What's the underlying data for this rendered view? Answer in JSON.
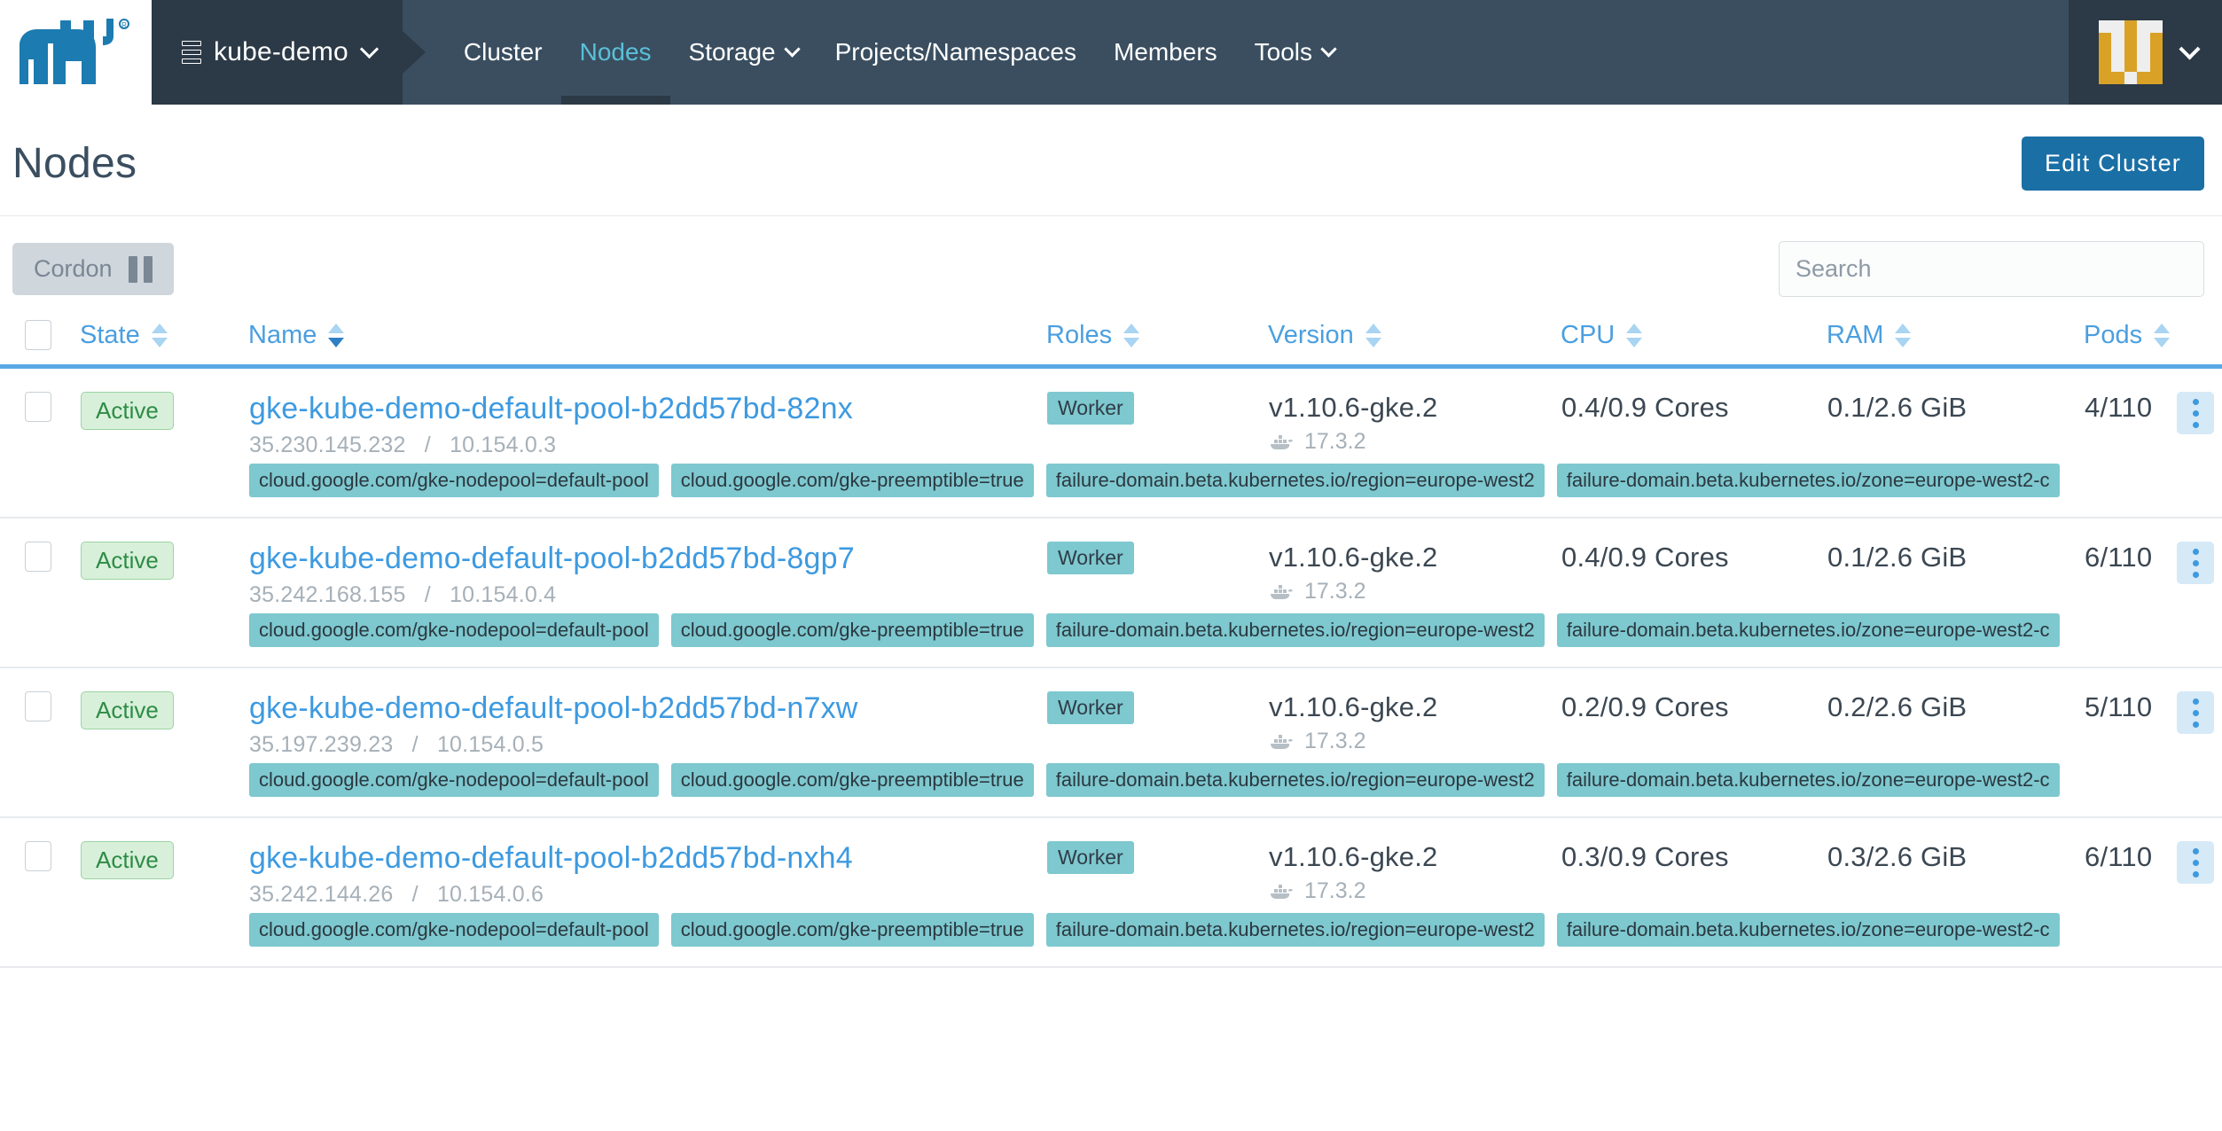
{
  "nav": {
    "logo_name": "rancher-cow-logo",
    "cluster": {
      "label": "kube-demo",
      "icon": "cluster-stack-icon"
    },
    "items": [
      {
        "label": "Cluster",
        "active": false,
        "caret": false
      },
      {
        "label": "Nodes",
        "active": true,
        "caret": false
      },
      {
        "label": "Storage",
        "active": false,
        "caret": true
      },
      {
        "label": "Projects/Namespaces",
        "active": false,
        "caret": false
      },
      {
        "label": "Members",
        "active": false,
        "caret": false
      },
      {
        "label": "Tools",
        "active": false,
        "caret": true
      }
    ],
    "avatar": {
      "name": "user-avatar-identicon",
      "fg": "#d9a227",
      "bg": "#eeeeee"
    }
  },
  "page": {
    "title": "Nodes",
    "edit_cluster_label": "Edit Cluster"
  },
  "toolbar": {
    "cordon_label": "Cordon",
    "cordon_icon": "pause-icon",
    "cordon_disabled": true,
    "search_placeholder": "Search",
    "search_value": ""
  },
  "table": {
    "columns": [
      {
        "key": "checkbox",
        "label": "",
        "sortable": false
      },
      {
        "key": "state",
        "label": "State",
        "sortable": true,
        "sort": "none"
      },
      {
        "key": "name",
        "label": "Name",
        "sortable": true,
        "sort": "asc"
      },
      {
        "key": "roles",
        "label": "Roles",
        "sortable": true,
        "sort": "none"
      },
      {
        "key": "version",
        "label": "Version",
        "sortable": true,
        "sort": "none"
      },
      {
        "key": "cpu",
        "label": "CPU",
        "sortable": true,
        "sort": "none"
      },
      {
        "key": "ram",
        "label": "RAM",
        "sortable": true,
        "sort": "none"
      },
      {
        "key": "pods",
        "label": "Pods",
        "sortable": true,
        "sort": "none"
      }
    ],
    "rows": [
      {
        "state": "Active",
        "name": "gke-kube-demo-default-pool-b2dd57bd-82nx",
        "external_ip": "35.230.145.232",
        "internal_ip": "10.154.0.3",
        "ip_separator": "/",
        "role": "Worker",
        "version": "v1.10.6-gke.2",
        "docker_version": "17.3.2",
        "cpu": "0.4/0.9 Cores",
        "ram": "0.1/2.6 GiB",
        "pods": "4/110",
        "labels": [
          "cloud.google.com/gke-nodepool=default-pool",
          "cloud.google.com/gke-preemptible=true",
          "failure-domain.beta.kubernetes.io/region=europe-west2",
          "failure-domain.beta.kubernetes.io/zone=europe-west2-c"
        ]
      },
      {
        "state": "Active",
        "name": "gke-kube-demo-default-pool-b2dd57bd-8gp7",
        "external_ip": "35.242.168.155",
        "internal_ip": "10.154.0.4",
        "ip_separator": "/",
        "role": "Worker",
        "version": "v1.10.6-gke.2",
        "docker_version": "17.3.2",
        "cpu": "0.4/0.9 Cores",
        "ram": "0.1/2.6 GiB",
        "pods": "6/110",
        "labels": [
          "cloud.google.com/gke-nodepool=default-pool",
          "cloud.google.com/gke-preemptible=true",
          "failure-domain.beta.kubernetes.io/region=europe-west2",
          "failure-domain.beta.kubernetes.io/zone=europe-west2-c"
        ]
      },
      {
        "state": "Active",
        "name": "gke-kube-demo-default-pool-b2dd57bd-n7xw",
        "external_ip": "35.197.239.23",
        "internal_ip": "10.154.0.5",
        "ip_separator": "/",
        "role": "Worker",
        "version": "v1.10.6-gke.2",
        "docker_version": "17.3.2",
        "cpu": "0.2/0.9 Cores",
        "ram": "0.2/2.6 GiB",
        "pods": "5/110",
        "labels": [
          "cloud.google.com/gke-nodepool=default-pool",
          "cloud.google.com/gke-preemptible=true",
          "failure-domain.beta.kubernetes.io/region=europe-west2",
          "failure-domain.beta.kubernetes.io/zone=europe-west2-c"
        ]
      },
      {
        "state": "Active",
        "name": "gke-kube-demo-default-pool-b2dd57bd-nxh4",
        "external_ip": "35.242.144.26",
        "internal_ip": "10.154.0.6",
        "ip_separator": "/",
        "role": "Worker",
        "version": "v1.10.6-gke.2",
        "docker_version": "17.3.2",
        "cpu": "0.3/0.9 Cores",
        "ram": "0.3/2.6 GiB",
        "pods": "6/110",
        "labels": [
          "cloud.google.com/gke-nodepool=default-pool",
          "cloud.google.com/gke-preemptible=true",
          "failure-domain.beta.kubernetes.io/region=europe-west2",
          "failure-domain.beta.kubernetes.io/zone=europe-west2-c"
        ]
      }
    ]
  },
  "colors": {
    "nav_bg": "#3a4e60",
    "nav_chip_bg": "#2c3946",
    "accent_blue": "#3d9ae0",
    "primary_button": "#1a6fa5",
    "active_badge_bg": "#d8f0da",
    "active_badge_text": "#2e8b46",
    "chip_teal": "#7ec8cf",
    "header_link": "#4a9fe0",
    "logo_blue": "#1c7bb0"
  }
}
